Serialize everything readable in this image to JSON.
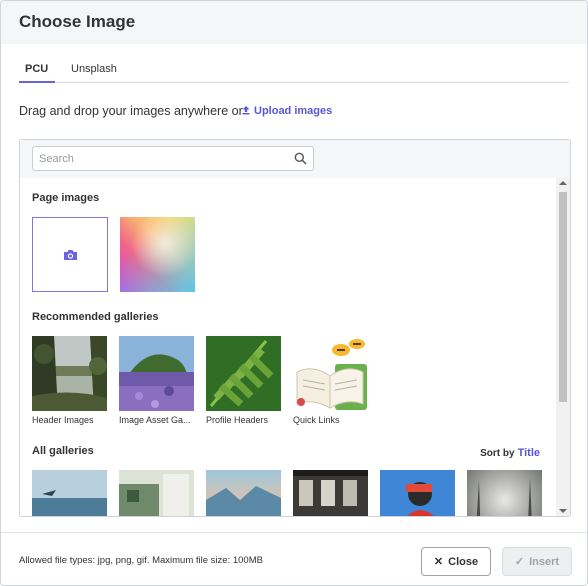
{
  "dialog": {
    "title": "Choose Image"
  },
  "tabs": [
    {
      "label": "PCU",
      "active": true
    },
    {
      "label": "Unsplash",
      "active": false
    }
  ],
  "upload": {
    "prompt": "Drag and drop your images anywhere or",
    "link_label": "Upload images",
    "icon": "upload-icon"
  },
  "search": {
    "placeholder": "Search",
    "value": "",
    "icon": "search-icon"
  },
  "page_images": {
    "label": "Page images",
    "upload_tile_icon": "camera-icon"
  },
  "recommended": {
    "label": "Recommended galleries",
    "items": [
      {
        "caption": "Header Images"
      },
      {
        "caption": "Image Asset Ga..."
      },
      {
        "caption": "Profile Headers"
      },
      {
        "caption": "Quick Links"
      }
    ]
  },
  "all_galleries": {
    "label": "All galleries",
    "sort_label": "Sort by",
    "sort_value": "Title"
  },
  "footer": {
    "note": "Allowed file types: jpg, png, gif. Maximum file size: 100MB",
    "close_label": "Close",
    "close_icon": "close-icon",
    "insert_label": "Insert",
    "insert_icon": "check-icon"
  },
  "colors": {
    "accent": "#5b55d6",
    "header_bg": "#f5f6f8",
    "border": "#cfd3da"
  }
}
